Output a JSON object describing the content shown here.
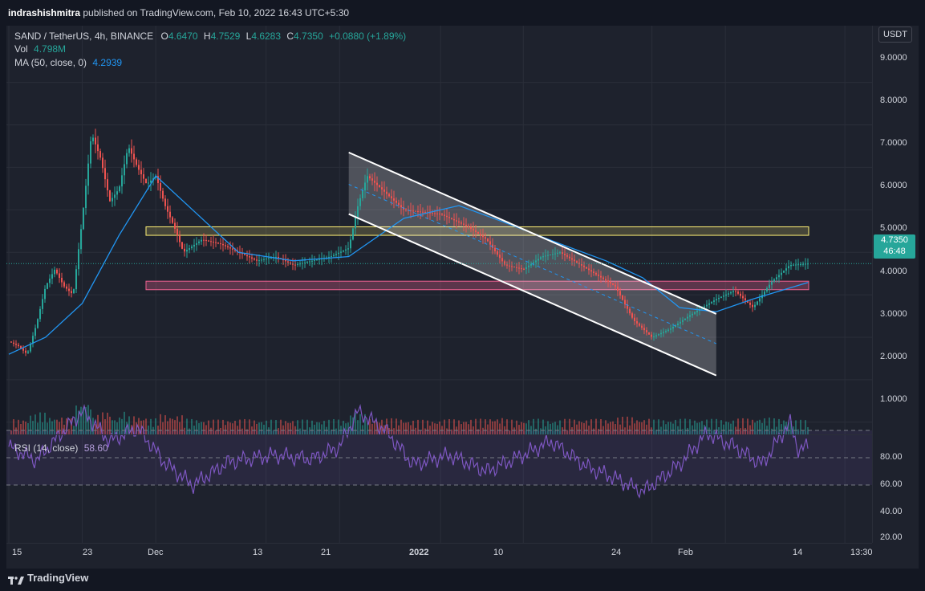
{
  "header": {
    "publisher": "indrashishmitra",
    "published_text": "published on TradingView.com, Feb 10, 2022 16:43 UTC+5:30"
  },
  "legend": {
    "symbol": "SAND / TetherUS, 4h, BINANCE",
    "o_label": "O",
    "o_value": "4.6470",
    "h_label": "H",
    "h_value": "4.7529",
    "l_label": "L",
    "l_value": "4.6283",
    "c_label": "C",
    "c_value": "4.7350",
    "change": "+0.0880 (+1.89%)",
    "vol_label": "Vol",
    "vol_value": "4.798M",
    "ma_label": "MA (50, close, 0)",
    "ma_value": "4.2939",
    "rsi_label": "RSI (14, close)",
    "rsi_value": "58.60"
  },
  "price_axis": {
    "currency_button": "USDT",
    "labels": [
      "9.0000",
      "8.0000",
      "7.0000",
      "6.0000",
      "5.0000",
      "4.0000",
      "3.0000",
      "2.0000",
      "1.0000"
    ],
    "current_price": "4.7350",
    "countdown": "46:48"
  },
  "rsi_axis": {
    "labels": [
      "80.00",
      "60.00",
      "40.00",
      "20.00"
    ]
  },
  "time_axis": {
    "labels": [
      "15",
      "23",
      "Dec",
      "13",
      "21",
      "2022",
      "10",
      "24",
      "Feb",
      "14",
      "13:30"
    ]
  },
  "footer": {
    "brand": "TradingView"
  },
  "colors": {
    "up": "#26a69a",
    "down": "#ef5350",
    "ma": "#2196f3",
    "rsi": "#7e57c2",
    "resistance_zone": "#fff176",
    "support_zone": "#f06292",
    "channel": "#ffffff"
  },
  "chart_data": {
    "type": "candlestick",
    "symbol": "SAND/USDT",
    "timeframe": "4h",
    "ylim": [
      0.2,
      9.9
    ],
    "y_ticks": [
      1,
      2,
      3,
      4,
      5,
      6,
      7,
      8,
      9
    ],
    "x_range": [
      "2021-11-15",
      "2022-02-16"
    ],
    "price_path": [
      [
        "2021-11-15",
        2.9
      ],
      [
        "2021-11-16",
        2.8
      ],
      [
        "2021-11-17",
        2.6
      ],
      [
        "2021-11-18",
        3.3
      ],
      [
        "2021-11-19",
        4.2
      ],
      [
        "2021-11-20",
        4.6
      ],
      [
        "2021-11-21",
        4.2
      ],
      [
        "2021-11-22",
        4.0
      ],
      [
        "2021-11-23",
        5.8
      ],
      [
        "2021-11-24",
        7.8
      ],
      [
        "2021-11-25",
        7.2
      ],
      [
        "2021-11-26",
        6.2
      ],
      [
        "2021-11-27",
        6.5
      ],
      [
        "2021-11-28",
        7.5
      ],
      [
        "2021-11-29",
        7.0
      ],
      [
        "2021-11-30",
        6.6
      ],
      [
        "2021-12-01",
        6.8
      ],
      [
        "2021-12-02",
        6.1
      ],
      [
        "2021-12-03",
        5.6
      ],
      [
        "2021-12-04",
        5.0
      ],
      [
        "2021-12-06",
        5.3
      ],
      [
        "2021-12-08",
        5.2
      ],
      [
        "2021-12-10",
        5.0
      ],
      [
        "2021-12-12",
        4.8
      ],
      [
        "2021-12-14",
        4.9
      ],
      [
        "2021-12-16",
        4.7
      ],
      [
        "2021-12-18",
        4.8
      ],
      [
        "2021-12-20",
        4.9
      ],
      [
        "2021-12-22",
        5.1
      ],
      [
        "2021-12-23",
        6.1
      ],
      [
        "2021-12-24",
        6.8
      ],
      [
        "2021-12-26",
        6.4
      ],
      [
        "2021-12-28",
        6.0
      ],
      [
        "2022-01-01",
        5.9
      ],
      [
        "2022-01-04",
        5.6
      ],
      [
        "2022-01-06",
        5.3
      ],
      [
        "2022-01-08",
        4.7
      ],
      [
        "2022-01-10",
        4.6
      ],
      [
        "2022-01-12",
        4.9
      ],
      [
        "2022-01-14",
        5.0
      ],
      [
        "2022-01-17",
        4.6
      ],
      [
        "2022-01-20",
        4.2
      ],
      [
        "2022-01-22",
        3.4
      ],
      [
        "2022-01-24",
        3.0
      ],
      [
        "2022-01-26",
        3.2
      ],
      [
        "2022-01-28",
        3.5
      ],
      [
        "2022-01-31",
        3.9
      ],
      [
        "2022-02-02",
        4.1
      ],
      [
        "2022-02-04",
        3.7
      ],
      [
        "2022-02-06",
        4.3
      ],
      [
        "2022-02-08",
        4.7
      ],
      [
        "2022-02-10",
        4.735
      ]
    ],
    "ma_50_path": [
      [
        "2021-11-15",
        2.6
      ],
      [
        "2021-11-19",
        3.0
      ],
      [
        "2021-11-23",
        3.8
      ],
      [
        "2021-11-27",
        5.4
      ],
      [
        "2021-12-01",
        6.8
      ],
      [
        "2021-12-05",
        6.0
      ],
      [
        "2021-12-10",
        5.0
      ],
      [
        "2021-12-16",
        4.8
      ],
      [
        "2021-12-22",
        4.9
      ],
      [
        "2021-12-28",
        5.8
      ],
      [
        "2022-01-03",
        6.1
      ],
      [
        "2022-01-08",
        5.7
      ],
      [
        "2022-01-14",
        5.2
      ],
      [
        "2022-01-19",
        4.8
      ],
      [
        "2022-01-23",
        4.4
      ],
      [
        "2022-01-27",
        3.7
      ],
      [
        "2022-01-31",
        3.6
      ],
      [
        "2022-02-04",
        3.9
      ],
      [
        "2022-02-10",
        4.29
      ]
    ],
    "rsi": {
      "ylim": [
        20,
        90
      ],
      "bands": [
        30,
        50,
        70
      ],
      "path": [
        [
          "2021-11-15",
          58
        ],
        [
          "2021-11-18",
          48
        ],
        [
          "2021-11-21",
          70
        ],
        [
          "2021-11-23",
          84
        ],
        [
          "2021-11-26",
          62
        ],
        [
          "2021-11-29",
          72
        ],
        [
          "2021-12-02",
          46
        ],
        [
          "2021-12-05",
          30
        ],
        [
          "2021-12-09",
          47
        ],
        [
          "2021-12-14",
          52
        ],
        [
          "2021-12-18",
          49
        ],
        [
          "2021-12-21",
          58
        ],
        [
          "2021-12-23",
          84
        ],
        [
          "2021-12-26",
          70
        ],
        [
          "2021-12-29",
          45
        ],
        [
          "2022-01-02",
          52
        ],
        [
          "2022-01-06",
          40
        ],
        [
          "2022-01-10",
          52
        ],
        [
          "2022-01-13",
          62
        ],
        [
          "2022-01-17",
          43
        ],
        [
          "2022-01-20",
          35
        ],
        [
          "2022-01-23",
          25
        ],
        [
          "2022-01-27",
          45
        ],
        [
          "2022-01-30",
          68
        ],
        [
          "2022-02-02",
          58
        ],
        [
          "2022-02-05",
          45
        ],
        [
          "2022-02-08",
          76
        ],
        [
          "2022-02-09",
          55
        ],
        [
          "2022-02-10",
          58.6
        ]
      ]
    },
    "drawings": {
      "resistance_zone": [
        5.4,
        5.6
      ],
      "support_zone": [
        4.12,
        4.32
      ],
      "channel_upper": [
        [
          "2021-12-22",
          7.35
        ],
        [
          "2022-01-31",
          3.55
        ]
      ],
      "channel_lower": [
        [
          "2021-12-22",
          5.9
        ],
        [
          "2022-01-31",
          2.1
        ]
      ],
      "channel_mid": [
        [
          "2021-12-22",
          6.6
        ],
        [
          "2022-01-31",
          2.85
        ]
      ]
    }
  }
}
